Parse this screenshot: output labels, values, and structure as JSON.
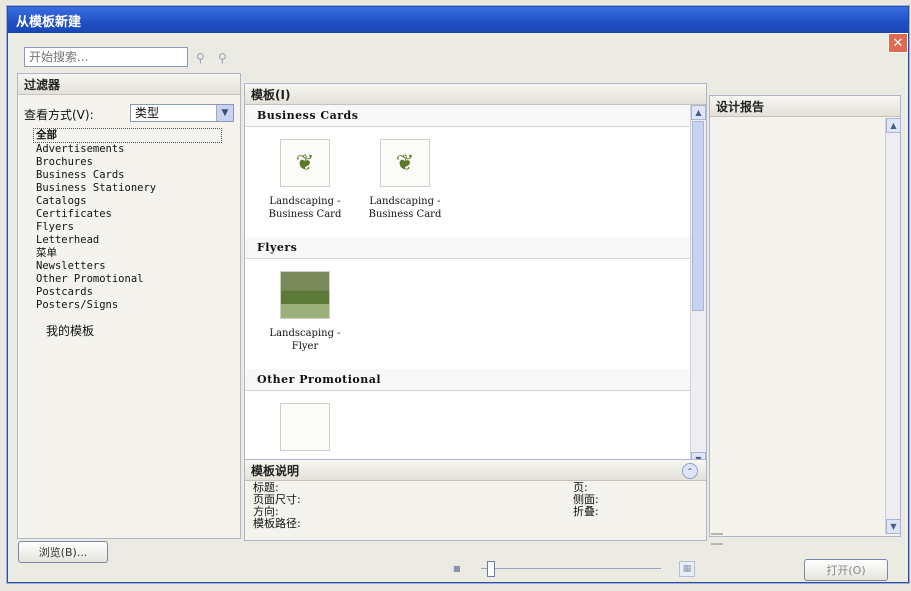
{
  "window": {
    "title": "从模板新建",
    "close_glyph": "✕"
  },
  "search": {
    "placeholder": "开始搜索..."
  },
  "filter": {
    "header": "过滤器",
    "view_label": "查看方式(V):",
    "view_selected": "类型",
    "categories": [
      "全部",
      "Advertisements",
      "Brochures",
      "Business Cards",
      "Business Stationery",
      "Catalogs",
      "Certificates",
      "Flyers",
      "Letterhead",
      "菜单",
      "Newsletters",
      "Other Promotional",
      "Postcards",
      "Posters/Signs"
    ],
    "my_templates": "我的模板"
  },
  "templates": {
    "header": "模板(I)",
    "sections": [
      {
        "title": "Business Cards",
        "items": [
          {
            "label_line1": "Landscaping -",
            "label_line2": "Business Card"
          },
          {
            "label_line1": "Landscaping -",
            "label_line2": "Business Card"
          }
        ]
      },
      {
        "title": "Flyers",
        "items": [
          {
            "label_line1": "Landscaping -",
            "label_line2": "Flyer"
          }
        ]
      },
      {
        "title": "Other Promotional",
        "items": []
      }
    ]
  },
  "description": {
    "header": "模板说明",
    "title_label": "标题:",
    "page_size_label": "页面尺寸:",
    "orientation_label": "方向:",
    "path_label": "模板路径:",
    "pages_label": "页:",
    "sides_label": "侧面:",
    "fold_label": "折叠:"
  },
  "report": {
    "header": "设计报告"
  },
  "buttons": {
    "browse": "浏览(B)...",
    "open": "打开(O)"
  },
  "colors": {
    "titlebar": "#1e4fc4",
    "close": "#e06a4f",
    "selection_border": "#555555"
  }
}
